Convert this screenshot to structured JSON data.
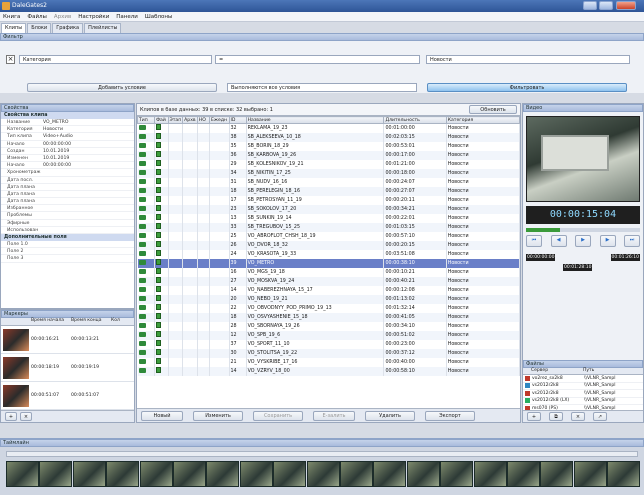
{
  "window": {
    "title": "DaleGates2"
  },
  "menu": [
    "Книга",
    "Файлы",
    "Архив",
    "Настройки",
    "Панели",
    "Шаблоны"
  ],
  "tabs": [
    "Клипы",
    "Блоки",
    "Графика",
    "Плейлисты"
  ],
  "filter": {
    "title": "Фильтр",
    "field": "Категория",
    "value": "Новости",
    "add_button": "Добавить условие",
    "mode": "Выполняются все условия",
    "apply_button": "Фильтровать"
  },
  "properties": {
    "title": "Свойства",
    "group1": "Свойства клипа",
    "rows": [
      {
        "k": "Название",
        "v": "VO_METRO"
      },
      {
        "k": "Категория",
        "v": "Новости"
      },
      {
        "k": "Тип клипа",
        "v": "Video+Audio"
      },
      {
        "k": "Начало",
        "v": "00:00:00:00"
      },
      {
        "k": "Создан",
        "v": "10.01.2019"
      },
      {
        "k": "Изменен",
        "v": "10.01.2019"
      },
      {
        "k": "Начало",
        "v": "00:00:00:00"
      },
      {
        "k": "Хронометраж",
        "v": ""
      },
      {
        "k": "Дата посл.",
        "v": ""
      },
      {
        "k": "Дата плана",
        "v": ""
      },
      {
        "k": "Дата плана",
        "v": ""
      },
      {
        "k": "Дата плана",
        "v": ""
      },
      {
        "k": "Избранное",
        "v": ""
      },
      {
        "k": "Проблемы",
        "v": ""
      },
      {
        "k": "Эфирные",
        "v": ""
      },
      {
        "k": "Использован",
        "v": ""
      }
    ],
    "group2": "Дополнительные поля",
    "extra": [
      "Поле 1.0",
      "Поле 2",
      "Поле 3"
    ]
  },
  "markers": {
    "title": "Маркеры",
    "headers": [
      "",
      "Время начала",
      "Время конца",
      "Кол"
    ],
    "rows": [
      {
        "start": "00:00:16:21",
        "end": "00:00:13:21"
      },
      {
        "start": "00:00:18:19",
        "end": "00:00:19:19"
      },
      {
        "start": "00:00:51:07",
        "end": "00:00:51:07"
      }
    ]
  },
  "clips": {
    "summary": "Клипов в базе данных: 39  в списке: 32  выбрано: 1",
    "refresh": "Обновить",
    "headers": [
      "Тип",
      "Фай",
      "Этап",
      "Архв",
      "НО",
      "Ежедн",
      "ID",
      "Название",
      "Длительность",
      "Категория"
    ],
    "rows": [
      [
        "32",
        "REKLAMA_19_23",
        "00:01:00:00",
        "Новости"
      ],
      [
        "38",
        "SB_ALEKSEEVA_10_18",
        "00:02:03:15",
        "Новости"
      ],
      [
        "35",
        "SB_BORIN_18_29",
        "00:00:53:01",
        "Новости"
      ],
      [
        "36",
        "SB_KARBOVA_19_26",
        "00:00:17:00",
        "Новости"
      ],
      [
        "29",
        "SB_KOLESNIKOV_19_21",
        "00:01:21:00",
        "Новости"
      ],
      [
        "34",
        "SB_NIKITIN_17_25",
        "00:00:18:00",
        "Новости"
      ],
      [
        "31",
        "SB_NUDV_16_16",
        "00:00:24:07",
        "Новости"
      ],
      [
        "18",
        "SB_PERELEGIN_18_16",
        "00:00:27:07",
        "Новости"
      ],
      [
        "17",
        "SB_PETROSYAN_11_19",
        "00:00:20:11",
        "Новости"
      ],
      [
        "23",
        "SB_SOKOLOV_17_20",
        "00:00:34:21",
        "Новости"
      ],
      [
        "13",
        "SB_SUNKIN_19_14",
        "00:00:22:01",
        "Новости"
      ],
      [
        "33",
        "SB_TREGUBOV_15_25",
        "00:01:03:15",
        "Новости"
      ],
      [
        "25",
        "VO_ABROFLOT_CHSH_18_19",
        "00:00:57:10",
        "Новости"
      ],
      [
        "26",
        "VO_DVOR_18_32",
        "00:00:20:15",
        "Новости"
      ],
      [
        "24",
        "VO_KRASOTA_19_33",
        "00:03:51:08",
        "Новости"
      ],
      [
        "39",
        "VO_METRO",
        "00:00:38:10",
        "Новости"
      ],
      [
        "16",
        "VO_MGS_19_18",
        "00:00:10:21",
        "Новости"
      ],
      [
        "27",
        "VO_MOSKVA_19_24",
        "00:00:40:21",
        "Новости"
      ],
      [
        "14",
        "VO_NABEREZHNAYA_15_17",
        "00:00:12:08",
        "Новости"
      ],
      [
        "20",
        "VO_NEBO_19_21",
        "00:01:13:02",
        "Новости"
      ],
      [
        "22",
        "VO_OBVODNYY_POD_PRIMO_19_13",
        "00:01:32:14",
        "Новости"
      ],
      [
        "18",
        "VO_OSVYASHENIE_15_18",
        "00:00:41:05",
        "Новости"
      ],
      [
        "28",
        "VO_SBORNAYA_19_26",
        "00:00:34:10",
        "Новости"
      ],
      [
        "12",
        "VO_SPB_19_6",
        "00:00:51:02",
        "Новости"
      ],
      [
        "37",
        "VO_SPORT_11_10",
        "00:00:23:00",
        "Новости"
      ],
      [
        "30",
        "VO_STOLITSA_19_22",
        "00:00:37:12",
        "Новости"
      ],
      [
        "21",
        "VO_VYSKRIBE_17_16",
        "00:00:40:00",
        "Новости"
      ],
      [
        "14",
        "VO_VZRYV_18_00",
        "00:00:58:10",
        "Новости"
      ]
    ],
    "selected_index": 15,
    "actions": {
      "new": "Новый",
      "edit": "Изменить",
      "save": "Сохранить",
      "upload": "Е-залить",
      "delete": "Удалить",
      "export": "Экспорт"
    }
  },
  "video": {
    "title": "Видео",
    "timecode": "00:00:15:04",
    "tc_in": "00:00:00:00",
    "tc_out": "00:01:26:10",
    "tc_dur": "00:01:28:10"
  },
  "files": {
    "title": "Файлы",
    "headers": [
      "Сервер",
      "Путь"
    ],
    "rows": [
      {
        "server": "vo2rez_sx2k8",
        "path": "\\\\VLNR_Sampl"
      },
      {
        "server": "vs2012r2k8",
        "path": "\\\\VLNR_Sampl"
      },
      {
        "server": "vs2012r2k8",
        "path": "\\\\VLNR_Sampl"
      },
      {
        "server": "vs2012r2k8 (LX)",
        "path": "\\\\VLNR_Sampl"
      },
      {
        "server": "ms070 (PS)",
        "path": "\\\\VLNR_Sampl"
      }
    ]
  },
  "timeline": {
    "title": "Таймлайн"
  }
}
